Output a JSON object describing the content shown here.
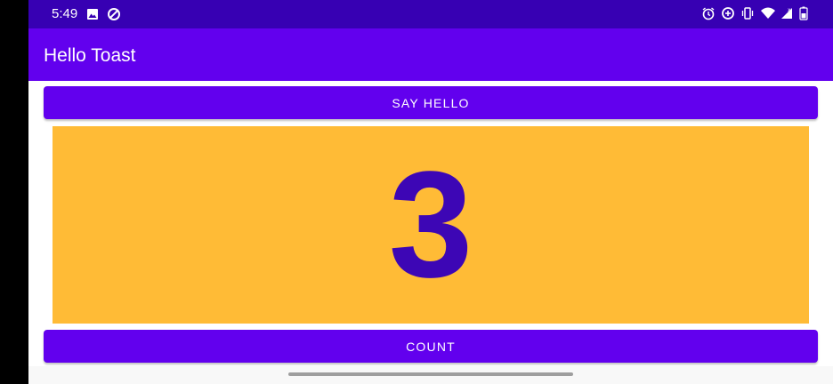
{
  "status_bar": {
    "time": "5:49",
    "left_icons": [
      "image-icon",
      "data-saver-icon"
    ],
    "right_icons": [
      "alarm-icon",
      "data-saver-plus-icon",
      "vibrate-icon",
      "wifi-icon",
      "cell-signal-icon",
      "battery-icon"
    ]
  },
  "app_bar": {
    "title": "Hello Toast"
  },
  "buttons": {
    "say_hello": "SAY HELLO",
    "count": "COUNT"
  },
  "counter": {
    "value": "3"
  },
  "colors": {
    "status_bar": "#3700b3",
    "primary": "#6200ee",
    "count_background": "#ffbb36",
    "count_text": "#3d06b5"
  }
}
